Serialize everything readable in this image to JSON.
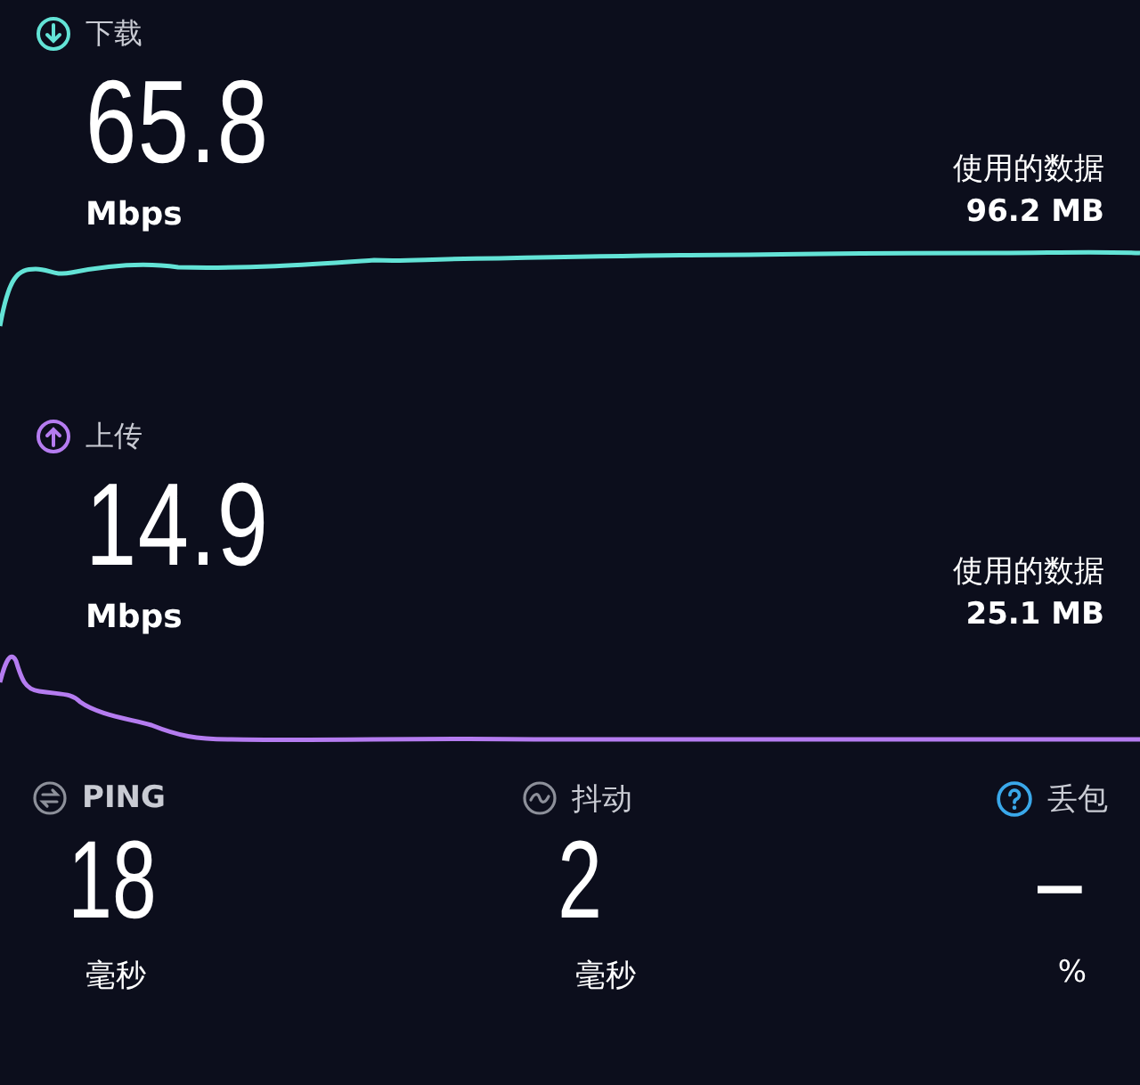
{
  "tests": [
    {
      "kind": "download",
      "label": "下载",
      "value": "65.8",
      "unit": "Mbps",
      "data_label": "使用的数据",
      "data_value": "96.2 MB"
    },
    {
      "kind": "upload",
      "label": "上传",
      "value": "14.9",
      "unit": "Mbps",
      "data_label": "使用的数据",
      "data_value": "25.1 MB"
    }
  ],
  "metrics": [
    {
      "kind": "ping",
      "label": "PING",
      "value": "18",
      "unit": "毫秒"
    },
    {
      "kind": "jitter",
      "label": "抖动",
      "value": "2",
      "unit": "毫秒"
    },
    {
      "kind": "loss",
      "label": "丢包",
      "value": "–",
      "unit": "%"
    }
  ]
}
